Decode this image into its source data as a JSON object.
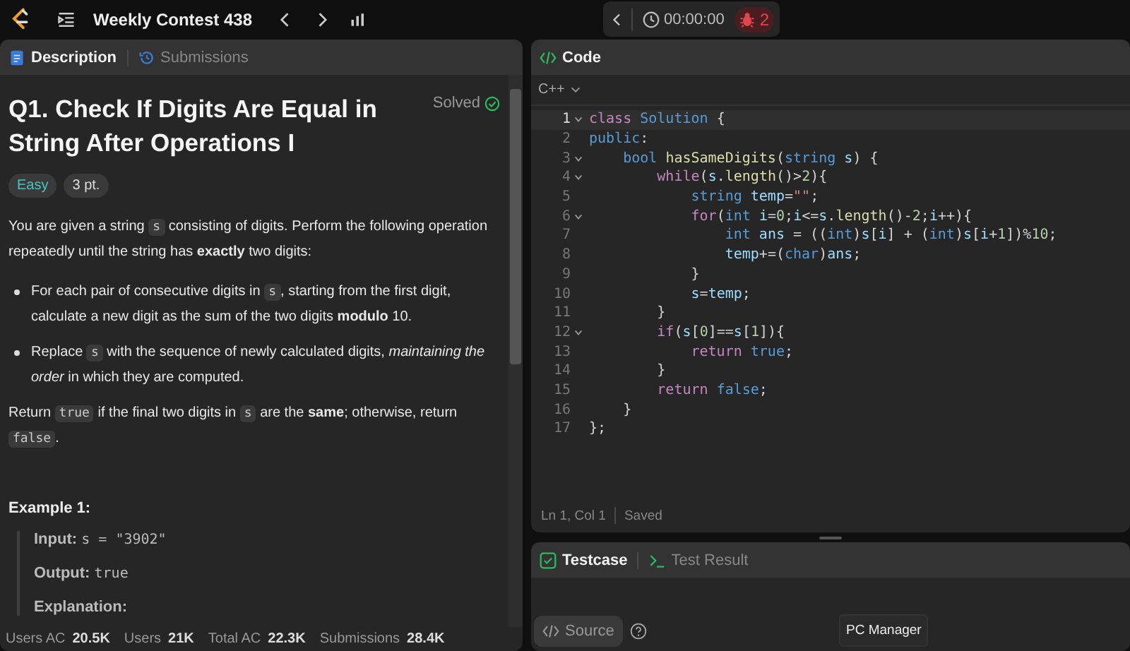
{
  "topbar": {
    "contest_title": "Weekly Contest 438",
    "timer": "00:00:00",
    "bug_count": "2"
  },
  "description_panel": {
    "tabs": [
      {
        "label": "Description",
        "selected": true
      },
      {
        "label": "Submissions",
        "selected": false
      }
    ],
    "title": "Q1. Check If Digits Are Equal in String After Operations I",
    "status": "Solved",
    "tags": [
      {
        "label": "Easy",
        "kind": "difficulty"
      },
      {
        "label": "3 pt.",
        "kind": "points"
      }
    ],
    "body": [
      {
        "kind": "para",
        "parts": [
          {
            "kind": "text",
            "text": "You are given a string "
          },
          {
            "kind": "code",
            "text": "s"
          },
          {
            "kind": "text",
            "text": " consisting of digits. Perform the following operation repeatedly until the string has **exactly** two digits:"
          }
        ]
      },
      {
        "kind": "bullet",
        "parts": [
          {
            "kind": "text",
            "text": "For each pair of consecutive digits in "
          },
          {
            "kind": "code",
            "text": "s"
          },
          {
            "kind": "text",
            "text": ", starting from the first digit, calculate a new digit as the sum of the two digits **modulo** 10."
          }
        ]
      },
      {
        "kind": "bullet",
        "parts": [
          {
            "kind": "text",
            "text": "Replace "
          },
          {
            "kind": "code",
            "text": "s"
          },
          {
            "kind": "text",
            "text": " with the sequence of newly calculated digits, *maintaining the order* in which they are computed."
          }
        ]
      },
      {
        "kind": "para",
        "parts": [
          {
            "kind": "text",
            "text": "Return "
          },
          {
            "kind": "code",
            "text": "true"
          },
          {
            "kind": "text",
            "text": " if the final two digits in "
          },
          {
            "kind": "code",
            "text": "s"
          },
          {
            "kind": "text",
            "text": " are the **same**; otherwise, return "
          },
          {
            "kind": "code",
            "text": "false"
          },
          {
            "kind": "text",
            "text": "."
          }
        ]
      }
    ],
    "example": {
      "heading": "Example 1:",
      "lines": [
        {
          "label": "Input:",
          "value": "s = \"3902\""
        },
        {
          "label": "Output:",
          "value": "true"
        },
        {
          "label": "Explanation:"
        }
      ]
    },
    "stats": [
      {
        "label": "Users AC",
        "value": "20.5K"
      },
      {
        "label": "Users",
        "value": "21K"
      },
      {
        "label": "Total AC",
        "value": "22.3K"
      },
      {
        "label": "Submissions",
        "value": "28.4K"
      }
    ]
  },
  "code_panel": {
    "title": "Code",
    "language": "C++",
    "lines": [
      {
        "n": "1",
        "fold": true,
        "tokens": [
          {
            "kind": "kw",
            "text": "class "
          },
          {
            "kind": "type",
            "text": "Solution"
          },
          {
            "kind": "p",
            "text": " {"
          }
        ]
      },
      {
        "n": "2",
        "fold": false,
        "tokens": [
          {
            "kind": "type",
            "text": "public"
          },
          {
            "kind": "p",
            "text": ":"
          }
        ]
      },
      {
        "n": "3",
        "fold": true,
        "tokens": [
          {
            "kind": "type",
            "text": "    bool "
          },
          {
            "kind": "fn",
            "text": "hasSameDigits"
          },
          {
            "kind": "p",
            "text": "("
          },
          {
            "kind": "type",
            "text": "string "
          },
          {
            "kind": "v",
            "text": "s"
          },
          {
            "kind": "p",
            "text": ") {"
          }
        ]
      },
      {
        "n": "4",
        "fold": true,
        "tokens": [
          {
            "kind": "kw",
            "text": "        while"
          },
          {
            "kind": "p",
            "text": "("
          },
          {
            "kind": "v",
            "text": "s"
          },
          {
            "kind": "p",
            "text": "."
          },
          {
            "kind": "fn",
            "text": "length"
          },
          {
            "kind": "p",
            "text": "()>"
          },
          {
            "kind": "num",
            "text": "2"
          },
          {
            "kind": "p",
            "text": "){"
          }
        ]
      },
      {
        "n": "5",
        "fold": false,
        "tokens": [
          {
            "kind": "type",
            "text": "            string "
          },
          {
            "kind": "v",
            "text": "temp"
          },
          {
            "kind": "p",
            "text": "="
          },
          {
            "kind": "str",
            "text": "\"\""
          },
          {
            "kind": "p",
            "text": ";"
          }
        ]
      },
      {
        "n": "6",
        "fold": true,
        "tokens": [
          {
            "kind": "kw",
            "text": "            for"
          },
          {
            "kind": "p",
            "text": "("
          },
          {
            "kind": "type",
            "text": "int "
          },
          {
            "kind": "v",
            "text": "i"
          },
          {
            "kind": "p",
            "text": "="
          },
          {
            "kind": "num",
            "text": "0"
          },
          {
            "kind": "p",
            "text": ";"
          },
          {
            "kind": "v",
            "text": "i"
          },
          {
            "kind": "p",
            "text": "<="
          },
          {
            "kind": "v",
            "text": "s"
          },
          {
            "kind": "p",
            "text": "."
          },
          {
            "kind": "fn",
            "text": "length"
          },
          {
            "kind": "p",
            "text": "()-"
          },
          {
            "kind": "num",
            "text": "2"
          },
          {
            "kind": "p",
            "text": ";"
          },
          {
            "kind": "v",
            "text": "i"
          },
          {
            "kind": "p",
            "text": "++){"
          }
        ]
      },
      {
        "n": "7",
        "fold": false,
        "tokens": [
          {
            "kind": "type",
            "text": "                int "
          },
          {
            "kind": "v",
            "text": "ans"
          },
          {
            "kind": "p",
            "text": " = (("
          },
          {
            "kind": "type",
            "text": "int"
          },
          {
            "kind": "p",
            "text": ")"
          },
          {
            "kind": "v",
            "text": "s"
          },
          {
            "kind": "p",
            "text": "["
          },
          {
            "kind": "v",
            "text": "i"
          },
          {
            "kind": "p",
            "text": "] + ("
          },
          {
            "kind": "type",
            "text": "int"
          },
          {
            "kind": "p",
            "text": ")"
          },
          {
            "kind": "v",
            "text": "s"
          },
          {
            "kind": "p",
            "text": "["
          },
          {
            "kind": "v",
            "text": "i"
          },
          {
            "kind": "p",
            "text": "+"
          },
          {
            "kind": "num",
            "text": "1"
          },
          {
            "kind": "p",
            "text": "])%"
          },
          {
            "kind": "num",
            "text": "10"
          },
          {
            "kind": "p",
            "text": ";"
          }
        ]
      },
      {
        "n": "8",
        "fold": false,
        "tokens": [
          {
            "kind": "v",
            "text": "                temp"
          },
          {
            "kind": "p",
            "text": "+=("
          },
          {
            "kind": "type",
            "text": "char"
          },
          {
            "kind": "p",
            "text": ")"
          },
          {
            "kind": "v",
            "text": "ans"
          },
          {
            "kind": "p",
            "text": ";"
          }
        ]
      },
      {
        "n": "9",
        "fold": false,
        "tokens": [
          {
            "kind": "p",
            "text": "            }"
          }
        ]
      },
      {
        "n": "10",
        "fold": false,
        "tokens": [
          {
            "kind": "v",
            "text": "            s"
          },
          {
            "kind": "p",
            "text": "="
          },
          {
            "kind": "v",
            "text": "temp"
          },
          {
            "kind": "p",
            "text": ";"
          }
        ]
      },
      {
        "n": "11",
        "fold": false,
        "tokens": [
          {
            "kind": "p",
            "text": "        }"
          }
        ]
      },
      {
        "n": "12",
        "fold": true,
        "tokens": [
          {
            "kind": "kw",
            "text": "        if"
          },
          {
            "kind": "p",
            "text": "("
          },
          {
            "kind": "v",
            "text": "s"
          },
          {
            "kind": "p",
            "text": "["
          },
          {
            "kind": "num",
            "text": "0"
          },
          {
            "kind": "p",
            "text": "]=="
          },
          {
            "kind": "v",
            "text": "s"
          },
          {
            "kind": "p",
            "text": "["
          },
          {
            "kind": "num",
            "text": "1"
          },
          {
            "kind": "p",
            "text": "]){"
          }
        ]
      },
      {
        "n": "13",
        "fold": false,
        "tokens": [
          {
            "kind": "kw",
            "text": "            return "
          },
          {
            "kind": "type",
            "text": "true"
          },
          {
            "kind": "p",
            "text": ";"
          }
        ]
      },
      {
        "n": "14",
        "fold": false,
        "tokens": [
          {
            "kind": "p",
            "text": "        }"
          }
        ]
      },
      {
        "n": "15",
        "fold": false,
        "tokens": [
          {
            "kind": "kw",
            "text": "        return "
          },
          {
            "kind": "type",
            "text": "false"
          },
          {
            "kind": "p",
            "text": ";"
          }
        ]
      },
      {
        "n": "16",
        "fold": false,
        "tokens": [
          {
            "kind": "p",
            "text": "    }"
          }
        ]
      },
      {
        "n": "17",
        "fold": false,
        "tokens": [
          {
            "kind": "p",
            "text": "};"
          }
        ]
      }
    ],
    "cursor": "Ln 1, Col 1",
    "save_state": "Saved"
  },
  "test_panel": {
    "tabs": [
      {
        "label": "Testcase",
        "selected": true
      },
      {
        "label": "Test Result",
        "selected": false
      }
    ],
    "source_button": "Source"
  },
  "tooltip": "PC Manager"
}
